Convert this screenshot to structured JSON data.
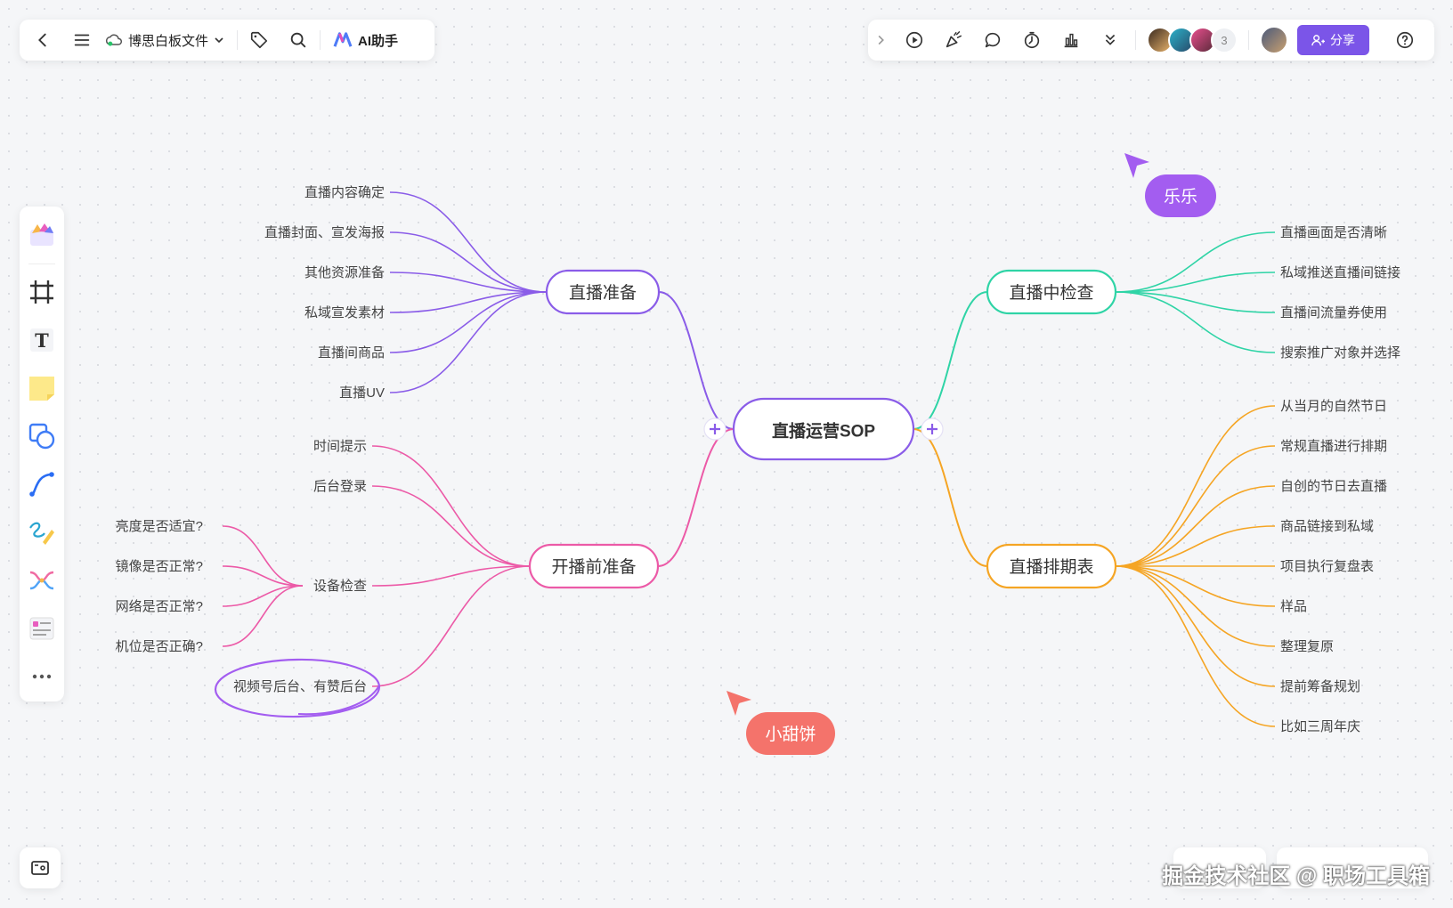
{
  "toolbar": {
    "file_title": "博思白板文件",
    "ai_label": "AI助手",
    "share_label": "分享",
    "collaborator_count": "3"
  },
  "mindmap": {
    "root": "直播运营SOP",
    "branches": [
      {
        "label": "直播准备",
        "color": "#8a5ce8",
        "children": [
          "直播内容确定",
          "直播封面、宣发海报",
          "其他资源准备",
          "私域宣发素材",
          "直播间商品",
          "直播UV"
        ]
      },
      {
        "label": "开播前准备",
        "color": "#ec5aa7",
        "children": [
          "时间提示",
          "后台登录",
          "设备检查",
          "视频号后台、有赞后台"
        ],
        "sub_children": [
          "亮度是否适宜?",
          "镜像是否正常?",
          "网络是否正常?",
          "机位是否正确?"
        ]
      },
      {
        "label": "直播中检查",
        "color": "#2fd4a6",
        "children": [
          "直播画面是否清晰",
          "私域推送直播间链接",
          "直播间流量券使用",
          "搜索推广对象并选择"
        ]
      },
      {
        "label": "直播排期表",
        "color": "#f5a524",
        "children": [
          "从当月的自然节日",
          "常规直播进行排期",
          "自创的节日去直播",
          "商品链接到私域",
          "项目执行复盘表",
          "样品",
          "整理复原",
          "提前筹备规划",
          "比如三周年庆"
        ]
      }
    ]
  },
  "cursors": [
    {
      "name": "乐乐",
      "color": "#a35df0"
    },
    {
      "name": "小甜饼",
      "color": "#f4736b"
    }
  ],
  "watermark": "掘金技术社区 @ 职场工具箱"
}
